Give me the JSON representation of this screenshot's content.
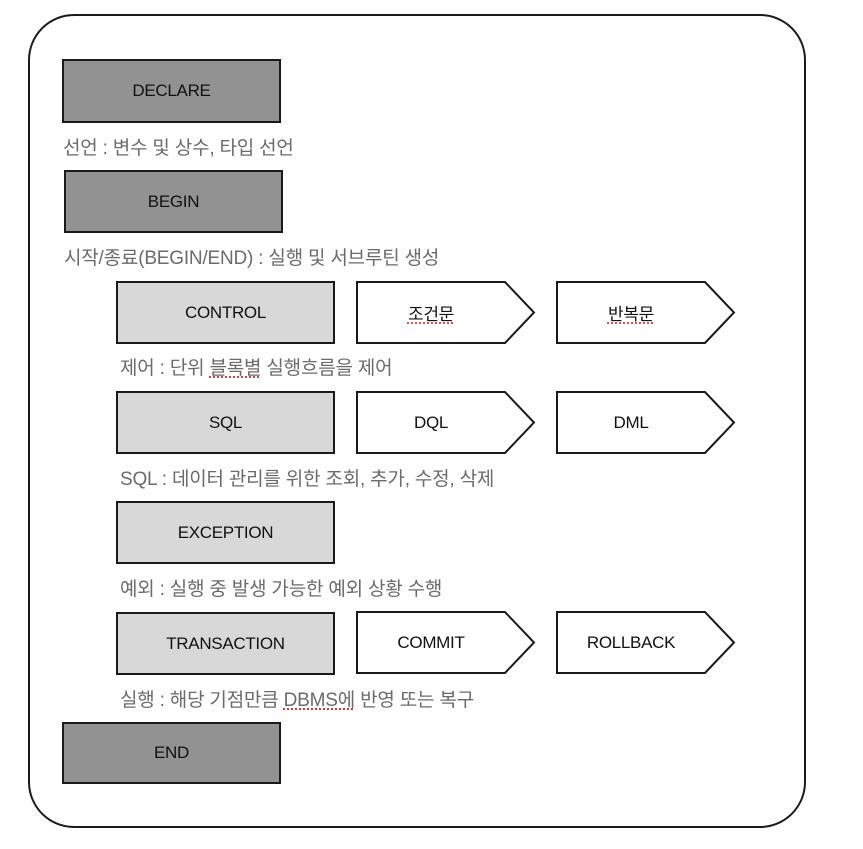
{
  "diagram": {
    "title_blocks": {
      "declare": {
        "label": "DECLARE",
        "desc": "선언 : 변수 및 상수, 타입 선언"
      },
      "begin": {
        "label": "BEGIN",
        "desc": "시작/종료(BEGIN/END) : 실행 및 서브루틴 생성"
      },
      "end": {
        "label": "END"
      }
    },
    "sections": [
      {
        "label": "CONTROL",
        "desc_pre": "제어 : 단위 ",
        "desc_mark": "블록별",
        "desc_post": " 실행흐름을 제어",
        "steps": [
          "조건문",
          "반복문"
        ]
      },
      {
        "label": "SQL",
        "desc": "SQL : 데이터 관리를 위한 조회, 추가, 수정, 삭제",
        "steps": [
          "DQL",
          "DML"
        ]
      },
      {
        "label": "EXCEPTION",
        "desc": "예외 : 실행 중 발생 가능한 예외 상황 수행",
        "steps": []
      },
      {
        "label": "TRANSACTION",
        "desc_pre": "실행 : 해당 기점만큼 ",
        "desc_mark": "DBMS에",
        "desc_post": " 반영 또는 복구",
        "steps": [
          "COMMIT",
          "ROLLBACK"
        ]
      }
    ],
    "colors": {
      "block_dark": "#929292",
      "block_light": "#d8d8d8",
      "outline": "#1a1a1a",
      "desc_text": "#6b6b6b"
    }
  }
}
